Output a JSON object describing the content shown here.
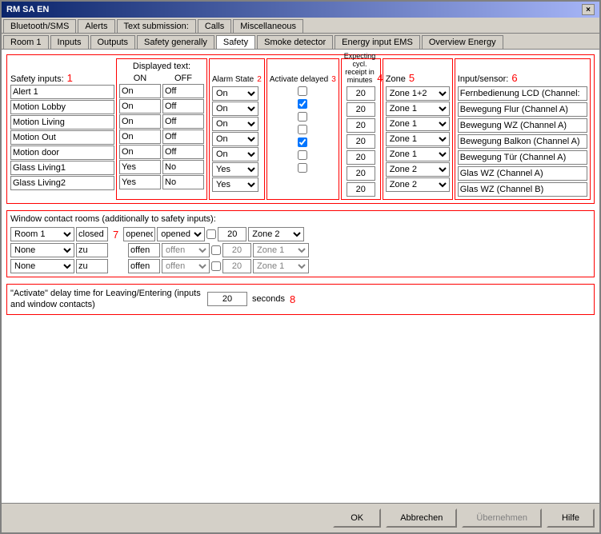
{
  "window": {
    "title": "RM SA EN",
    "close": "×"
  },
  "top_tabs": [
    {
      "label": "Bluetooth/SMS",
      "active": false
    },
    {
      "label": "Alerts",
      "active": false
    },
    {
      "label": "Text submission:",
      "active": false
    },
    {
      "label": "Calls",
      "active": false
    },
    {
      "label": "Miscellaneous",
      "active": false
    }
  ],
  "sub_tabs": [
    {
      "label": "Room 1",
      "active": false
    },
    {
      "label": "Inputs",
      "active": false
    },
    {
      "label": "Outputs",
      "active": false
    },
    {
      "label": "Safety generally",
      "active": false
    },
    {
      "label": "Safety",
      "active": true
    },
    {
      "label": "Smoke detector",
      "active": false
    },
    {
      "label": "Energy input EMS",
      "active": false
    },
    {
      "label": "Overview Energy",
      "active": false
    }
  ],
  "headers": {
    "safety_inputs": "Safety inputs:",
    "displayed_text": "Displayed text:",
    "on_label": "ON",
    "off_label": "OFF",
    "alarm_state": "Alarm State",
    "activate_delayed": "Activate delayed",
    "expecting": "Expecting cycl. receipt in minutes",
    "zone": "Zone",
    "input_sensor": "Input/sensor:",
    "num1": "1",
    "num2": "2",
    "num3": "3",
    "num4": "4",
    "num5": "5",
    "num6": "6"
  },
  "rows": [
    {
      "name": "Alert 1",
      "on": "On",
      "off": "Off",
      "alarm": "On",
      "activate": false,
      "expect": "20",
      "zone": "Zone 1+2",
      "sensor": "Fernbedienung LCD  (Channel:"
    },
    {
      "name": "Motion Lobby",
      "on": "On",
      "off": "Off",
      "alarm": "On",
      "activate": true,
      "expect": "20",
      "zone": "Zone 1",
      "sensor": "Bewegung Flur  (Channel A)"
    },
    {
      "name": "Motion Living",
      "on": "On",
      "off": "Off",
      "alarm": "On",
      "activate": false,
      "expect": "20",
      "zone": "Zone 1",
      "sensor": "Bewegung WZ  (Channel A)"
    },
    {
      "name": "Motion Out",
      "on": "On",
      "off": "Off",
      "alarm": "On",
      "activate": false,
      "expect": "20",
      "zone": "Zone 1",
      "sensor": "Bewegung Balkon  (Channel A)"
    },
    {
      "name": "Motion door",
      "on": "On",
      "off": "Off",
      "alarm": "On",
      "activate": true,
      "expect": "20",
      "zone": "Zone 1",
      "sensor": "Bewegung Tür  (Channel A)"
    },
    {
      "name": "Glass Living1",
      "on": "Yes",
      "off": "No",
      "alarm": "Yes",
      "activate": false,
      "expect": "20",
      "zone": "Zone 2",
      "sensor": "Glas WZ  (Channel A)"
    },
    {
      "name": "Glass Living2",
      "on": "Yes",
      "off": "No",
      "alarm": "Yes",
      "activate": false,
      "expect": "20",
      "zone": "Zone 2",
      "sensor": "Glas WZ  (Channel B)"
    }
  ],
  "window_contact": {
    "title": "Window contact rooms (additionally to safety inputs):",
    "num7": "7",
    "rows": [
      {
        "room": "Room 1",
        "state1": "closed",
        "state2": "opened",
        "alarm": "opened",
        "activate": false,
        "expect": "20",
        "zone": "Zone 2",
        "enabled": true
      },
      {
        "room": "None",
        "state1": "zu",
        "state2": "offen",
        "alarm": "offen",
        "activate": false,
        "expect": "20",
        "zone": "Zone 1",
        "enabled": false
      },
      {
        "room": "None",
        "state1": "zu",
        "state2": "offen",
        "alarm": "offen",
        "activate": false,
        "expect": "20",
        "zone": "Zone 1",
        "enabled": false
      }
    ]
  },
  "delay_section": {
    "label": "\"Activate\" delay time for Leaving/Entering (inputs\nand window contacts)",
    "value": "20",
    "unit": "seconds",
    "num8": "8"
  },
  "footer": {
    "ok": "OK",
    "cancel": "Abbrechen",
    "apply": "Übernehmen",
    "help": "Hilfe"
  }
}
